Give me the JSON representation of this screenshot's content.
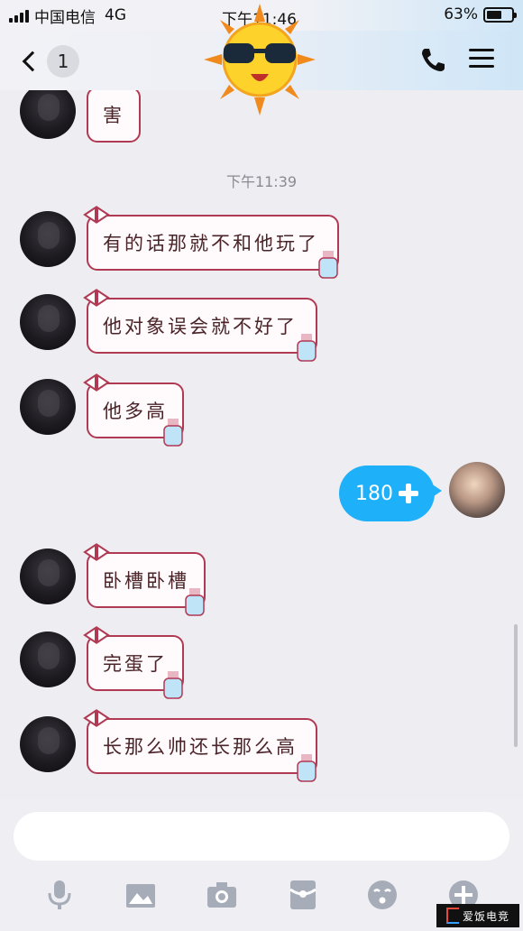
{
  "status_bar": {
    "carrier": "中国电信",
    "network": "4G",
    "time": "下午11:46",
    "battery": "63%",
    "battery_level": 0.63
  },
  "nav_bar": {
    "unread_count": "1",
    "back_icon": "chevron-left-icon",
    "call_icon": "phone-icon",
    "menu_icon": "menu-icon"
  },
  "chat": {
    "messages": [
      {
        "from": "other",
        "text": "害"
      },
      {
        "from": "system",
        "text": "下午11:39"
      },
      {
        "from": "other",
        "text": "有的话那就不和他玩了"
      },
      {
        "from": "other",
        "text": "他对象误会就不好了"
      },
      {
        "from": "other",
        "text": "他多高"
      },
      {
        "from": "me",
        "text": "180"
      },
      {
        "from": "other",
        "text": "卧槽卧槽"
      },
      {
        "from": "other",
        "text": "完蛋了"
      },
      {
        "from": "other",
        "text": "长那么帅还长那么高"
      }
    ]
  },
  "input": {
    "placeholder": ""
  },
  "toolbar": [
    {
      "icon": "microphone-icon"
    },
    {
      "icon": "image-icon"
    },
    {
      "icon": "camera-icon"
    },
    {
      "icon": "red-packet-icon"
    },
    {
      "icon": "emoji-icon"
    },
    {
      "icon": "plus-icon"
    }
  ],
  "watermark": {
    "text": "爱饭电竞"
  },
  "colors": {
    "my_bubble": "#1eb0f9",
    "bubble_border": "#b03a54",
    "background": "#ededf2"
  }
}
